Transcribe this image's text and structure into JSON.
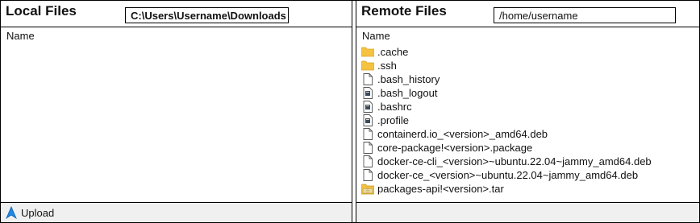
{
  "local": {
    "title": "Local Files",
    "path": "C:\\Users\\Username\\Downloads",
    "column_name": "Name",
    "upload_label": "Upload"
  },
  "remote": {
    "title": "Remote Files",
    "path": "/home/username",
    "column_name": "Name",
    "files": [
      {
        "name": ".cache",
        "icon": "folder-icon"
      },
      {
        "name": ".ssh",
        "icon": "folder-icon"
      },
      {
        "name": ".bash_history",
        "icon": "file-icon"
      },
      {
        "name": ".bash_logout",
        "icon": "script-file-icon"
      },
      {
        "name": ".bashrc",
        "icon": "script-file-icon"
      },
      {
        "name": ".profile",
        "icon": "script-file-icon"
      },
      {
        "name": "containerd.io_<version>_amd64.deb",
        "icon": "file-icon"
      },
      {
        "name": "core-package!<version>.package",
        "icon": "file-icon"
      },
      {
        "name": "docker-ce-cli_<version>~ubuntu.22.04~jammy_amd64.deb",
        "icon": "file-icon"
      },
      {
        "name": "docker-ce_<version>~ubuntu.22.04~jammy_amd64.deb",
        "icon": "file-icon"
      },
      {
        "name": "packages-api!<version>.tar",
        "icon": "archive-icon"
      }
    ]
  },
  "colors": {
    "folder": "#f5c242",
    "upload_arrow": "#1e88e5",
    "footer_bg": "#f0f0f0"
  }
}
